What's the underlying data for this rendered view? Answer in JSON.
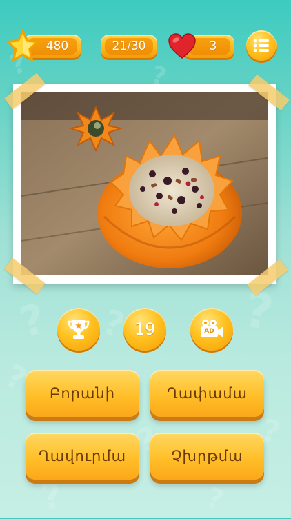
{
  "top_bar": {
    "coins": "480",
    "level": "21/30",
    "lives": "3"
  },
  "hint_bar": {
    "counter": "19",
    "video_badge": "AD"
  },
  "answers": [
    {
      "label": "Բորանի"
    },
    {
      "label": "Ղափամա"
    },
    {
      "label": "Ղավուրմա"
    },
    {
      "label": "Չխրթմա"
    }
  ],
  "colors": {
    "background_top": "#3dcbc0",
    "background_bottom": "#c6eee4",
    "button_yellow": "#ffbf28",
    "button_shadow": "#cc7a12",
    "heart_red": "#e0242b"
  },
  "icons": [
    "star-icon",
    "heart-icon",
    "menu-list-icon",
    "trophy-icon",
    "video-camera-icon"
  ]
}
